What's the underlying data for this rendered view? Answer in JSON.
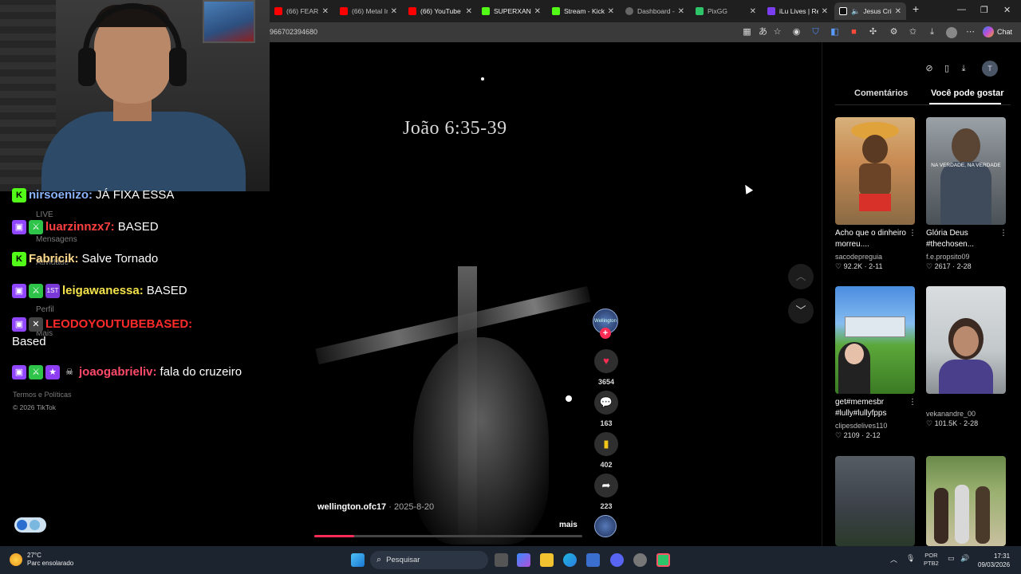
{
  "browser": {
    "tabs": [
      {
        "title": "(66) FEAR THE",
        "color": "#ff0000"
      },
      {
        "title": "(66) Metal Inst",
        "color": "#ff0000"
      },
      {
        "title": "(66) YouTube",
        "color": "#ff0000"
      },
      {
        "title": "SUPERXANDA",
        "color": "#53fc18"
      },
      {
        "title": "Stream - Kick D",
        "color": "#53fc18"
      },
      {
        "title": "Dashboard - L",
        "color": "#888888"
      },
      {
        "title": "PixGG",
        "color": "#2ec46a"
      },
      {
        "title": "iLu Lives | Rea",
        "color": "#7a3df0"
      },
      {
        "title": "Jesus Cris",
        "color": "#ffffff"
      }
    ],
    "url": "966702394680",
    "chat_label": "Chat"
  },
  "chat": {
    "ghost": {
      "live": "LIVE",
      "messages": "Mensagens",
      "activity": "Atividade",
      "profile": "Perfil",
      "more": "Mais",
      "terms": "Termos e Políticas"
    },
    "messages": [
      {
        "user": "nirsoenizo:",
        "text": "JÁ FIXA ESSA",
        "user_color": "#8bb4ff"
      },
      {
        "user": "luarzinnzx7:",
        "text": "BASED",
        "user_color": "#ff4040"
      },
      {
        "user": "Fabricik:",
        "text": "Salve Tornado",
        "user_color": "#ffd98c"
      },
      {
        "user": "leigawanessa:",
        "text": "BASED",
        "user_color": "#f4e34a"
      },
      {
        "user": "LEODOYOUTUBEBASED:",
        "text": "Based",
        "user_color": "#ff2a2a"
      },
      {
        "user": "joaogabrieliv:",
        "text": "fala do cruzeiro",
        "user_color": "#ff4a6a"
      }
    ],
    "copyright": "© 2026 TikTok"
  },
  "video": {
    "verse": "João 6:35-39",
    "author": "wellington.ofc17",
    "date": " · 2025-8-20",
    "more": "mais",
    "progress_percent": 15,
    "avatar_text": "Wellington",
    "likes": "3654",
    "comments": "163",
    "saves": "402",
    "shares": "223",
    "accent": "#fe2c55"
  },
  "panel": {
    "tabs": [
      "Comentários",
      "Você pode gostar"
    ],
    "avatar_letter": "T",
    "cards": [
      {
        "title": "Acho que o dinheiro morreu....",
        "user": "sacodepreguia",
        "likes": "92.2K",
        "date": "2-11",
        "thumb_text": ""
      },
      {
        "title": "Glória Deus #thechosen...",
        "user": "f.e.propsito09",
        "likes": "2617",
        "date": "2-28",
        "thumb_text": "NA VERDADE, NA VERDADE"
      },
      {
        "title": "get#memesbr #lully#lullyfpps",
        "user": "clipesdelives110",
        "likes": "2109",
        "date": "2-12",
        "thumb_text": ""
      },
      {
        "title": "",
        "user": "vekanandre_00",
        "likes": "101.5K",
        "date": "2-28",
        "thumb_text": ""
      },
      {
        "title": "",
        "user": "",
        "likes": "",
        "date": "",
        "thumb_text": ""
      },
      {
        "title": "",
        "user": "",
        "likes": "",
        "date": "",
        "thumb_text": ""
      }
    ]
  },
  "taskbar": {
    "temp": "27°C",
    "weather": "Parc ensolarado",
    "search": "Pesquisar",
    "lang": "POR",
    "layout": "PTB2",
    "time": "17:31",
    "date": "09/03/2026"
  }
}
